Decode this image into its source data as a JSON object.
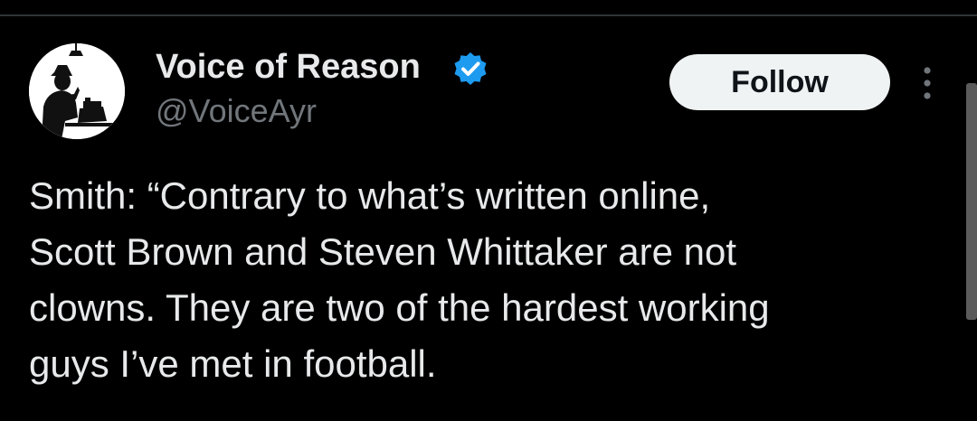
{
  "tweet": {
    "author": {
      "display_name": "Voice of Reason",
      "handle": "@VoiceAyr",
      "verified": true,
      "avatar_icon": "silhouette-typewriter-avatar"
    },
    "follow_label": "Follow",
    "more_icon": "more-vertical-icon",
    "text": "Smith: “Contrary to what’s written online,\nScott Brown and Steven Whittaker are not\nclowns. They are two of the hardest working\nguys I’ve met in football."
  },
  "colors": {
    "background": "#000000",
    "text_primary": "#e7e9ea",
    "text_secondary": "#71767b",
    "verified_blue": "#1d9bf0",
    "follow_button_bg": "#eff3f4",
    "follow_button_text": "#0f1419"
  }
}
